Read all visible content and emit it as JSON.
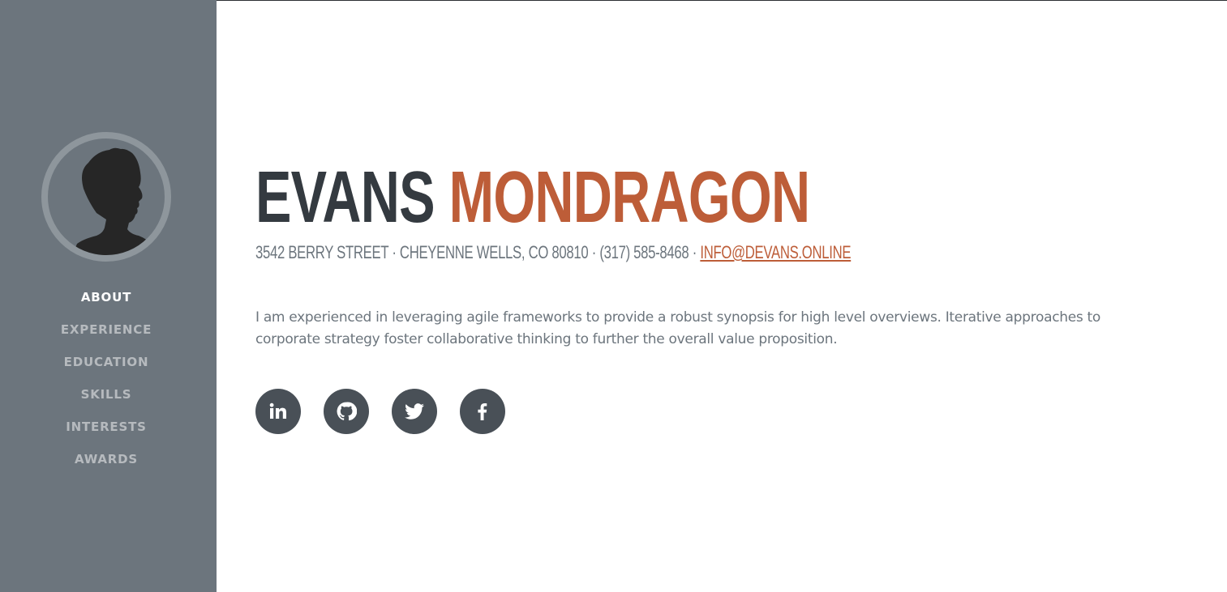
{
  "sidebar": {
    "nav": [
      {
        "label": "ABOUT",
        "active": true
      },
      {
        "label": "EXPERIENCE",
        "active": false
      },
      {
        "label": "EDUCATION",
        "active": false
      },
      {
        "label": "SKILLS",
        "active": false
      },
      {
        "label": "INTERESTS",
        "active": false
      },
      {
        "label": "AWARDS",
        "active": false
      }
    ]
  },
  "profile": {
    "first_name": "EVANS",
    "last_name": "MONDRAGON",
    "address": "3542 BERRY STREET · CHEYENNE WELLS, CO 80810 · (317) 585-8468 · ",
    "email": "INFO@DEVANS.ONLINE",
    "intro": "I am experienced in leveraging agile frameworks to provide a robust synopsis for high level overviews. Iterative approaches to corporate strategy foster collaborative thinking to further the overall value proposition."
  },
  "social": [
    {
      "icon": "linkedin-icon"
    },
    {
      "icon": "github-icon"
    },
    {
      "icon": "twitter-icon"
    },
    {
      "icon": "facebook-icon"
    }
  ],
  "colors": {
    "sidebar": "#6c757d",
    "accent": "#bd5d38",
    "dark": "#343a40",
    "icon_bg": "#495057"
  }
}
